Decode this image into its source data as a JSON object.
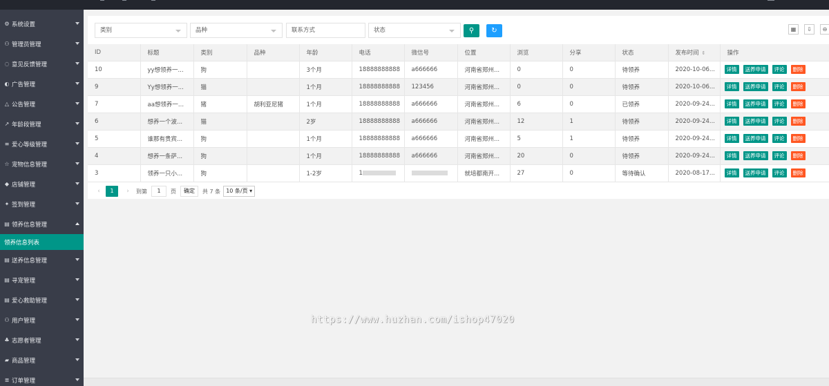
{
  "sidebar": {
    "items": [
      {
        "icon": "gear-icon",
        "glyph": "⚙",
        "label": "系统设置"
      },
      {
        "icon": "user-icon",
        "glyph": "⚇",
        "label": "管理员管理"
      },
      {
        "icon": "chat-icon",
        "glyph": "◌",
        "label": "意见反馈管理"
      },
      {
        "icon": "ad-icon",
        "glyph": "◐",
        "label": "广告管理"
      },
      {
        "icon": "bell-icon",
        "glyph": "△",
        "label": "公告管理"
      },
      {
        "icon": "chart-icon",
        "glyph": "↗",
        "label": "年龄段管理"
      },
      {
        "icon": "list-icon",
        "glyph": "≡",
        "label": "爱心等级管理"
      },
      {
        "icon": "star-icon",
        "glyph": "☆",
        "label": "宠物信息管理"
      },
      {
        "icon": "shop-icon",
        "glyph": "◆",
        "label": "店铺管理"
      },
      {
        "icon": "pin-icon",
        "glyph": "✦",
        "label": "签到管理"
      },
      {
        "icon": "menu-icon",
        "glyph": "▤",
        "label": "领养信息管理",
        "open": true
      },
      {
        "icon": "menu-icon",
        "glyph": "▤",
        "label": "送养信息管理"
      },
      {
        "icon": "menu-icon",
        "glyph": "▤",
        "label": "寻宠管理"
      },
      {
        "icon": "menu-icon",
        "glyph": "▤",
        "label": "爱心救助管理"
      },
      {
        "icon": "user-icon",
        "glyph": "⚇",
        "label": "用户管理"
      },
      {
        "icon": "volunteer-icon",
        "glyph": "♣",
        "label": "志愿者管理"
      },
      {
        "icon": "goods-icon",
        "glyph": "▰",
        "label": "商品管理"
      },
      {
        "icon": "order-icon",
        "glyph": "≣",
        "label": "订单管理"
      }
    ],
    "active_sub": "领养信息列表"
  },
  "filters": {
    "category_placeholder": "类别",
    "breed_placeholder": "品种",
    "contact_placeholder": "联系方式",
    "status_placeholder": "状态"
  },
  "table": {
    "headers": [
      "ID",
      "标题",
      "类别",
      "品种",
      "年龄",
      "电话",
      "微信号",
      "位置",
      "浏览",
      "分享",
      "状态",
      "发布时间",
      "操作"
    ],
    "rows": [
      [
        "10",
        "yy想领养一...",
        "狗",
        "",
        "3个月",
        "18888888888",
        "a666666",
        "河南省郑州...",
        "0",
        "0",
        "待领养",
        "2020-10-06..."
      ],
      [
        "9",
        "Yy想领养一...",
        "猫",
        "",
        "1个月",
        "18888888888",
        "123456",
        "河南省郑州...",
        "0",
        "0",
        "待领养",
        "2020-10-06..."
      ],
      [
        "7",
        "aa想领养一...",
        "猪",
        "胡利亚尼猪",
        "1个月",
        "18888888888",
        "a666666",
        "河南省郑州...",
        "6",
        "0",
        "已领养",
        "2020-09-24..."
      ],
      [
        "6",
        "想养一个波...",
        "猫",
        "",
        "2岁",
        "18888888888",
        "a666666",
        "河南省郑州...",
        "12",
        "1",
        "待领养",
        "2020-09-24..."
      ],
      [
        "5",
        "谁那有贵宾...",
        "狗",
        "",
        "1个月",
        "18888888888",
        "a666666",
        "河南省郑州...",
        "5",
        "1",
        "待领养",
        "2020-09-24..."
      ],
      [
        "4",
        "想养一条萨...",
        "狗",
        "",
        "1个月",
        "18888888888",
        "a666666",
        "河南省郑州...",
        "20",
        "0",
        "待领养",
        "2020-09-24..."
      ],
      [
        "3",
        "领养一只小...",
        "狗",
        "",
        "1-2岁",
        "1",
        "",
        "就培都南开...",
        "27",
        "0",
        "等待确认",
        "2020-08-17..."
      ]
    ],
    "ops": [
      "详情",
      "送养申请",
      "评论",
      "删除"
    ]
  },
  "pager": {
    "current": "1",
    "goto_label": "到第",
    "goto_value": "1",
    "page_label": "页",
    "confirm": "确定",
    "total": "共 7 条",
    "size": "10 条/页"
  },
  "watermark": "https://www.huzhan.com/ishop47020",
  "colors": {
    "sidebar": "#393d49",
    "accent": "#009688",
    "blue": "#1e9fff",
    "danger": "#ff5722"
  }
}
